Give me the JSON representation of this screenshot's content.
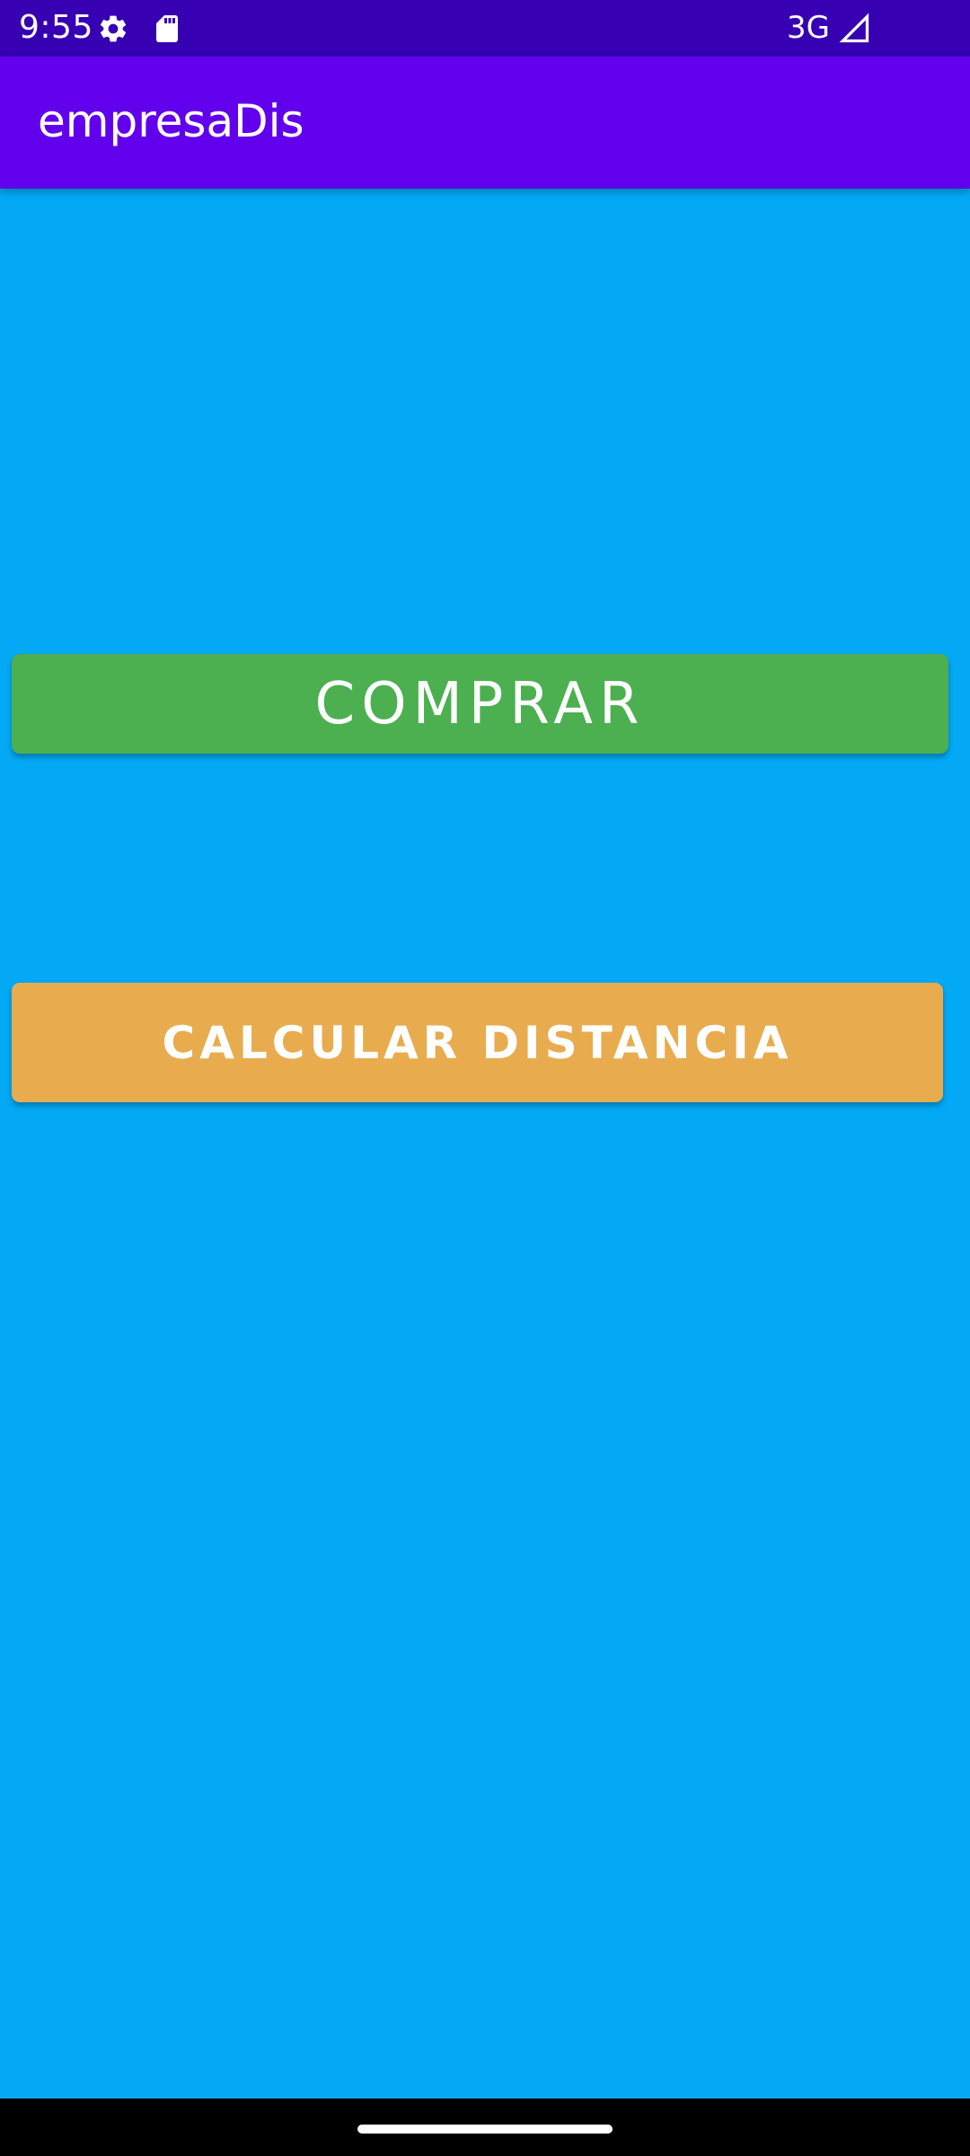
{
  "status_bar": {
    "time": "9:55",
    "icons": [
      "gear-icon",
      "sd-card-icon",
      "signal-icon"
    ],
    "network": "3G"
  },
  "app_bar": {
    "title": "empresaDis"
  },
  "main": {
    "buy_button": "COMPRAR",
    "distance_button": "CALCULAR DISTANCIA"
  },
  "colors": {
    "status_bar": "#3700B3",
    "app_bar": "#6200EE",
    "background": "#03A9F4",
    "buy_button": "#4CAF50",
    "distance_button": "#E8AC4F"
  }
}
